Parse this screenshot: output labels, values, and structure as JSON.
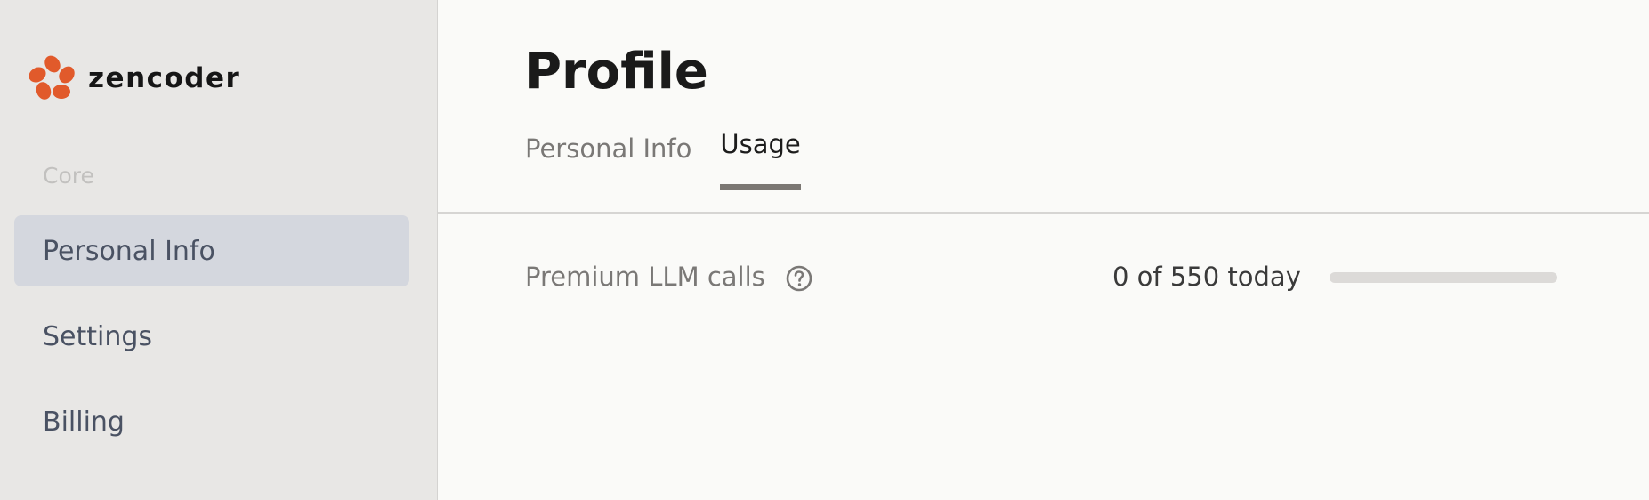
{
  "brand": {
    "name": "zencoder",
    "accent_color": "#e15a2b"
  },
  "sidebar": {
    "section_label": "Core",
    "items": [
      {
        "label": "Personal Info",
        "active": true
      },
      {
        "label": "Settings",
        "active": false
      },
      {
        "label": "Billing",
        "active": false
      }
    ]
  },
  "page": {
    "title": "Profile"
  },
  "tabs": [
    {
      "label": "Personal Info",
      "active": false
    },
    {
      "label": "Usage",
      "active": true
    }
  ],
  "usage": {
    "label": "Premium LLM calls",
    "help_icon": "question-circle-icon",
    "value_text": "0 of 550 today",
    "used": 0,
    "limit": 550
  }
}
